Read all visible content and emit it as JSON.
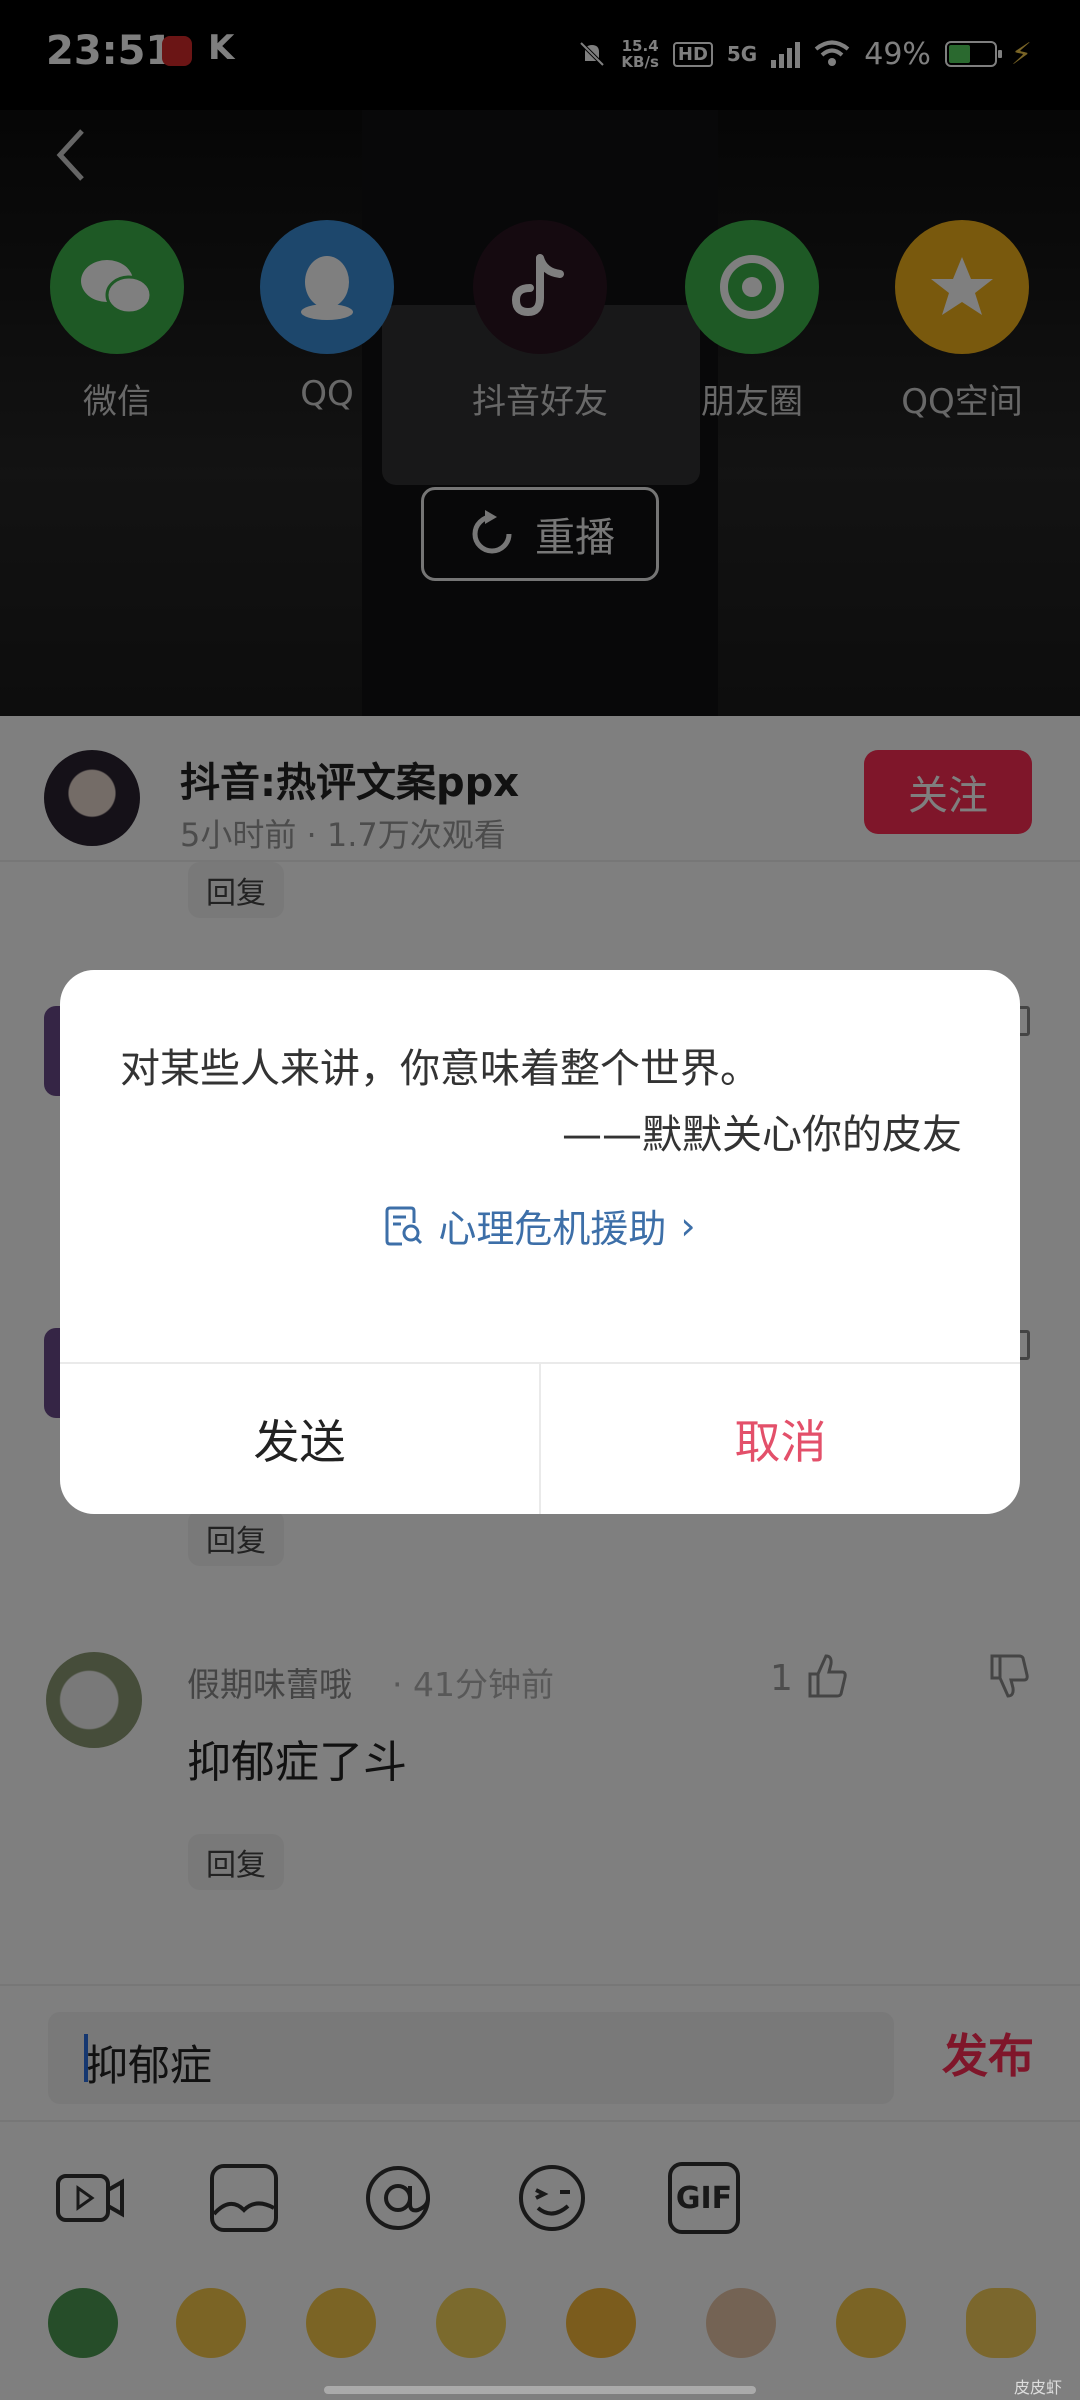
{
  "status_bar": {
    "time": "23:51",
    "app_k": "K",
    "net_speed_value": "15.4",
    "net_speed_unit": "KB/s",
    "hd": "HD",
    "signal": "5G",
    "battery": "49%"
  },
  "share": {
    "items": [
      {
        "label": "微信",
        "color": "#3cb34a",
        "icon": "wechat-icon"
      },
      {
        "label": "QQ",
        "color": "#3b8fd9",
        "icon": "qq-icon"
      },
      {
        "label": "抖音好友",
        "color": "#2a1420",
        "icon": "douyin-icon"
      },
      {
        "label": "朋友圈",
        "color": "#3cb34a",
        "icon": "moments-icon"
      },
      {
        "label": "QQ空间",
        "color": "#f3b21a",
        "icon": "qzone-icon"
      }
    ],
    "replay_label": "重播"
  },
  "author": {
    "name": "抖音:热评文案ppx",
    "time": "5小时前",
    "views": "1.7万次观看",
    "follow_label": "关注"
  },
  "comments": {
    "reply_label": "回复",
    "items": [
      {
        "name": "假期味蕾哦",
        "time": "· 41分钟前",
        "text": "抑郁症了斗",
        "likes": "1"
      }
    ]
  },
  "composer": {
    "input_value": "抑郁症",
    "publish_label": "发布",
    "tools": [
      "video-icon",
      "image-icon",
      "mention-icon",
      "emoji-icon",
      "gif-icon"
    ],
    "gif_label": "GIF"
  },
  "dialog": {
    "quote": "对某些人来讲，你意味着整个世界。",
    "signature": "——默默关心你的皮友",
    "help_link": "心理危机援助",
    "help_chevron": "›",
    "send_label": "发送",
    "cancel_label": "取消"
  },
  "watermark": "皮皮虾",
  "colors": {
    "accent": "#fe2c55",
    "link": "#3d6fa8",
    "cancel": "#e3506a"
  }
}
